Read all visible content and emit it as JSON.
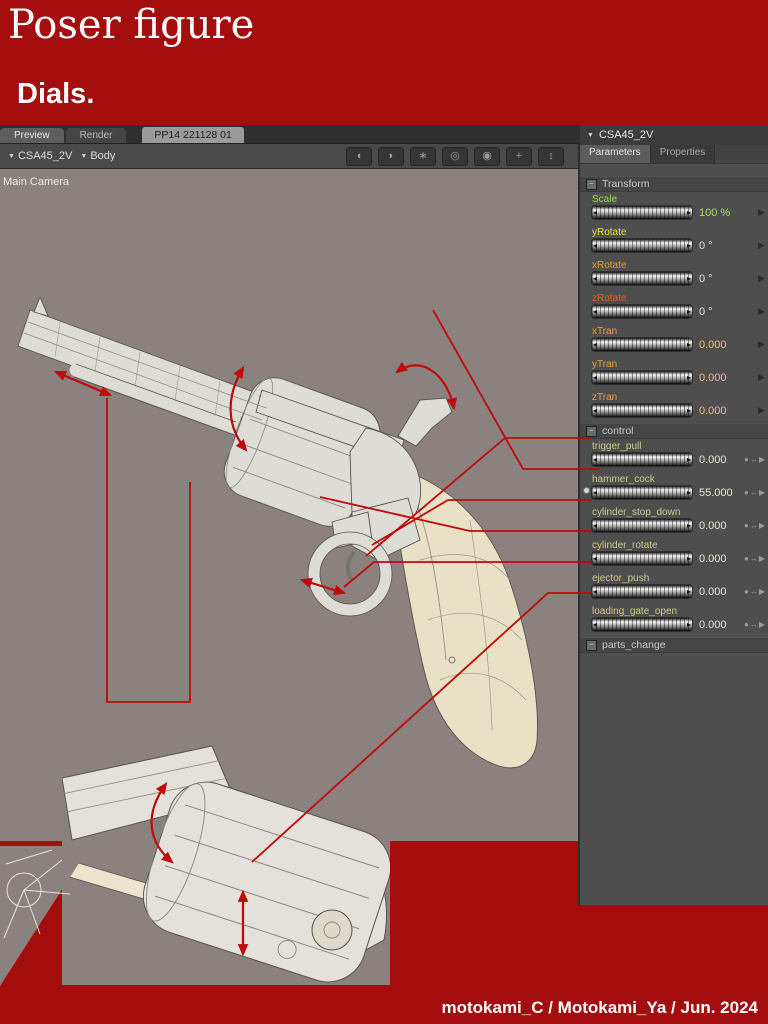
{
  "banner": {
    "title": "Poser figure",
    "subtitle": "Dials."
  },
  "tabs": {
    "preview": "Preview",
    "render": "Render",
    "document_title": "PP14 221128 01"
  },
  "selectors": {
    "figure": "CSA45_2V",
    "element": "Body"
  },
  "viewport": {
    "camera_label": "Main Camera"
  },
  "toolbar_icons": [
    "face-camera-left-icon",
    "face-camera-right-icon",
    "hand-camera-icon",
    "flyaround-camera-icon",
    "trackball-icon",
    "move-xy-icon",
    "move-z-icon"
  ],
  "panel": {
    "title": "CSA45_2V",
    "tabs": [
      {
        "label": "Parameters",
        "active": true
      },
      {
        "label": "Properties",
        "active": false
      }
    ],
    "groups": [
      {
        "name": "Transform",
        "dials": [
          {
            "label": "Scale",
            "value": "100 %",
            "label_color": "#9ade4e",
            "value_color": "#a9e065"
          },
          {
            "label": "yRotate",
            "value": "0 °",
            "label_color": "#e3e33c",
            "value_color": "#e0e0e0"
          },
          {
            "label": "xRotate",
            "value": "0 °",
            "label_color": "#e69b33",
            "value_color": "#e0e0e0"
          },
          {
            "label": "zRotate",
            "value": "0 °",
            "label_color": "#e4602c",
            "value_color": "#e0e0e0"
          },
          {
            "label": "xTran",
            "value": "0.000",
            "label_color": "#e6a23a",
            "value_color": "#e8c173"
          },
          {
            "label": "yTran",
            "value": "0.000",
            "label_color": "#e6a23a",
            "value_color": "#e8c173"
          },
          {
            "label": "zTran",
            "value": "0.000",
            "label_color": "#e6a23a",
            "value_color": "#e8c173"
          }
        ]
      },
      {
        "name": "control",
        "dials": [
          {
            "label": "trigger_pull",
            "value": "0.000",
            "label_color": "#cfc88e",
            "value_color": "#e9e6d2"
          },
          {
            "label": "hammer_cock",
            "value": "55.000",
            "label_color": "#cfc88e",
            "value_color": "#e9e6d2",
            "keyed": true
          },
          {
            "label": "cylinder_stop_down",
            "value": "0.000",
            "label_color": "#cfc88e",
            "value_color": "#e9e6d2"
          },
          {
            "label": "cylinder_rotate",
            "value": "0.000",
            "label_color": "#cfc88e",
            "value_color": "#e9e6d2"
          },
          {
            "label": "ejector_push",
            "value": "0.000",
            "label_color": "#cfc88e",
            "value_color": "#e9e6d2"
          },
          {
            "label": "loading_gate_open",
            "value": "0.000",
            "label_color": "#cfc88e",
            "value_color": "#e9e6d2"
          }
        ]
      },
      {
        "name": "parts_change",
        "dials": []
      }
    ]
  },
  "footer": {
    "credit": "motokami_C / Motokami_Ya / Jun. 2024"
  },
  "colors": {
    "background_red": "#a30d0d",
    "viewport_bg": "#8b8280",
    "panel_bg": "#4e4e4e",
    "annotation_red": "#c00909"
  }
}
